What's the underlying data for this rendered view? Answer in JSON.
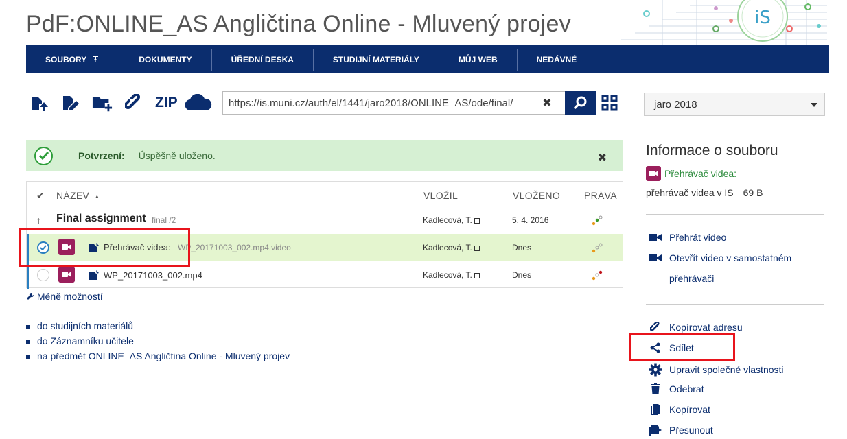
{
  "header": {
    "title": "PdF:ONLINE_AS Angličtina Online - Mluvený projev",
    "logo_text": "iS"
  },
  "nav": {
    "items": [
      {
        "label": "SOUBORY"
      },
      {
        "label": "DOKUMENTY"
      },
      {
        "label": "ÚŘEDNÍ DESKA"
      },
      {
        "label": "STUDIJNÍ MATERIÁLY"
      },
      {
        "label": "MŮJ WEB"
      },
      {
        "label": "NEDÁVNÉ"
      }
    ]
  },
  "toolbar": {
    "zip_label": "ZIP",
    "url_value": "https://is.muni.cz/auth/el/1441/jaro2018/ONLINE_AS/ode/final/",
    "clear_glyph": "✖"
  },
  "semester": {
    "selected": "jaro 2018"
  },
  "alert": {
    "label": "Potvrzení:",
    "message": "Úspěšně uloženo.",
    "close_glyph": "✖"
  },
  "table": {
    "headers": {
      "check": "✔",
      "name": "NÁZEV",
      "sort": "▲",
      "uploaded_by": "VLOŽIL",
      "uploaded": "VLOŽENO",
      "rights": "PRÁVA"
    },
    "parent": {
      "up_glyph": "↑",
      "name": "Final assignment",
      "path": "final /2",
      "uploaded_by": "Kadlecová, T.",
      "uploaded": "5. 4. 2016"
    },
    "rows": [
      {
        "name": "Přehrávač videa:",
        "file": "WP_20171003_002.mp4.video",
        "uploaded_by": "Kadlecová, T.",
        "uploaded": "Dnes"
      },
      {
        "name": "WP_20171003_002.mp4",
        "uploaded_by": "Kadlecová, T.",
        "uploaded": "Dnes"
      }
    ]
  },
  "less_options": "Méně možností",
  "links": [
    "do studijních materiálů",
    "do Záznamníku učitele",
    "na předmět ONLINE_AS Angličtina Online - Mluvený projev"
  ],
  "info": {
    "title": "Informace o souboru",
    "type_label": "Přehrávač videa:",
    "description": "přehrávač videa v IS",
    "size": "69 B",
    "actions_video": [
      "Přehrát video",
      "Otevřít video v samostatném",
      "přehrávači"
    ],
    "actions": [
      "Kopírovat adresu",
      "Sdílet",
      "Upravit společné vlastnosti",
      "Odebrat",
      "Kopírovat",
      "Přesunout"
    ]
  },
  "colors": {
    "brand": "#0b2d6e",
    "video": "#9b1f5c",
    "success_bg": "#d6f0d3",
    "selected_row": "#e4f5cf",
    "highlight": "#e8141c"
  }
}
